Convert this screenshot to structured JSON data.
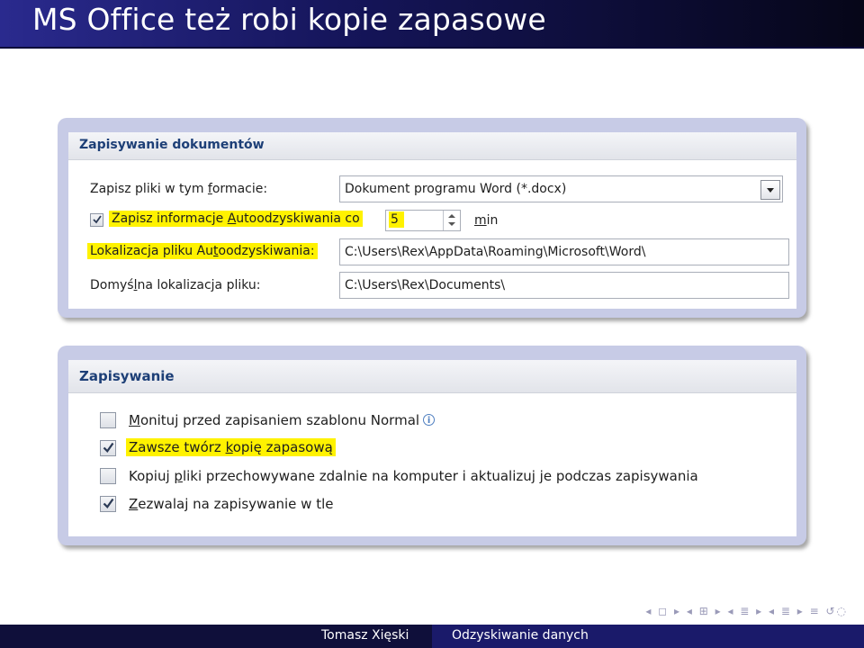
{
  "slide": {
    "title": "MS Office też robi kopie zapasowe"
  },
  "panel1": {
    "header": "Zapisywanie dokumentów",
    "format_label_prefix": "Zapisz pliki w tym ",
    "format_label_u": "f",
    "format_label_suffix": "ormacie:",
    "format_value": "Dokument programu Word (*.docx)",
    "autorecover_checked": true,
    "autorecover_label_prefix": "Zapisz informacje ",
    "autorecover_label_u": "A",
    "autorecover_label_suffix": "utoodzyskiwania co",
    "autorecover_minutes": "5",
    "minutes_unit_u": "m",
    "minutes_unit_suffix": "in",
    "autorecover_location_prefix": "Lokalizacja pliku Au",
    "autorecover_location_u": "t",
    "autorecover_location_suffix": "oodzyskiwania:",
    "autorecover_location_value": "C:\\Users\\Rex\\AppData\\Roaming\\Microsoft\\Word\\",
    "default_location_prefix": "Domyś",
    "default_location_u": "l",
    "default_location_suffix": "na lokalizacja pliku:",
    "default_location_value": "C:\\Users\\Rex\\Documents\\"
  },
  "panel2": {
    "header": "Zapisywanie",
    "options": [
      {
        "checked": false,
        "prefix": "",
        "u": "M",
        "suffix": "onituj przed zapisaniem szablonu Normal",
        "info": true
      },
      {
        "checked": true,
        "prefix": "Zawsze twórz ",
        "u": "k",
        "suffix": "opię zapasową",
        "info": false
      },
      {
        "checked": false,
        "prefix": "Kopiuj ",
        "u": "p",
        "suffix": "liki przechowywane zdalnie na komputer i aktualizuj je podczas zapisywania",
        "info": false
      },
      {
        "checked": true,
        "prefix": "",
        "u": "Z",
        "suffix": "ezwalaj na zapisywanie w tle",
        "info": false
      }
    ]
  },
  "footer": {
    "author": "Tomasz Xięski",
    "talk_title": "Odzyskiwanie danych"
  },
  "colors": {
    "title_bar": "#15155a",
    "highlight": "#fff200",
    "header_text": "#1d3f77",
    "footer_left": "#0f0f3a",
    "footer_right": "#1a1a6a"
  }
}
